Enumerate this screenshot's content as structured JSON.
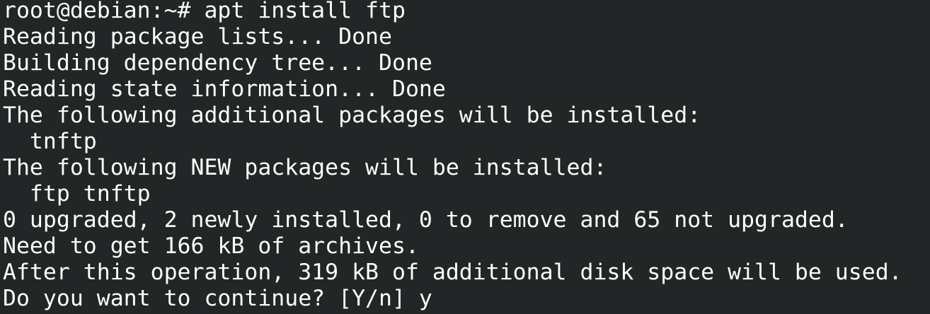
{
  "terminal": {
    "lines": [
      "root@debian:~# apt install ftp",
      "Reading package lists... Done",
      "Building dependency tree... Done",
      "Reading state information... Done",
      "The following additional packages will be installed:",
      "  tnftp",
      "The following NEW packages will be installed:",
      "  ftp tnftp",
      "0 upgraded, 2 newly installed, 0 to remove and 65 not upgraded.",
      "Need to get 166 kB of archives.",
      "After this operation, 319 kB of additional disk space will be used.",
      "Do you want to continue? [Y/n] y"
    ]
  },
  "colors": {
    "background": "#232627",
    "foreground": "#fcfcfc"
  }
}
